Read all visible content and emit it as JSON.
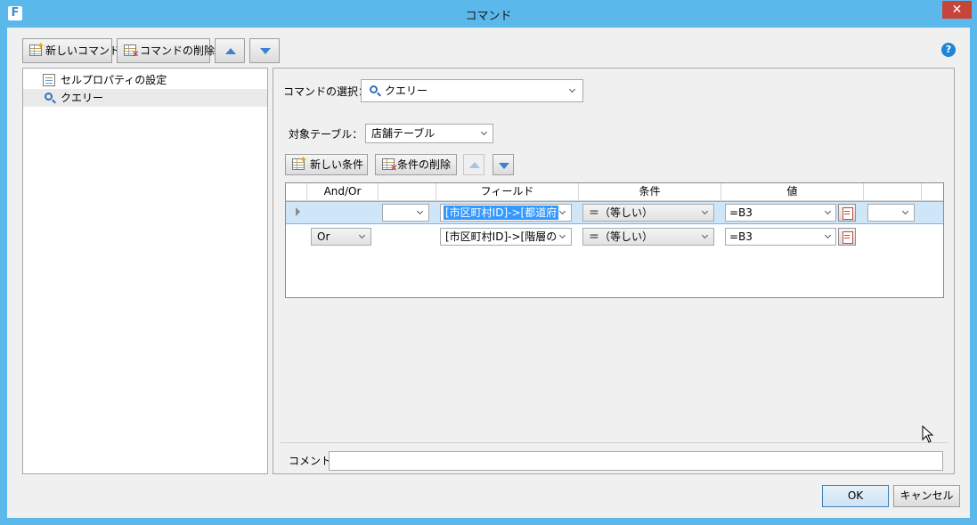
{
  "window": {
    "title": "コマンド",
    "app_icon_letter": "F",
    "close_glyph": "✕"
  },
  "toolbar": {
    "new_command_label": "新しいコマンド",
    "delete_command_label": "コマンドの削除",
    "help_glyph": "?"
  },
  "tree": {
    "items": [
      {
        "label": "セルプロパティの設定",
        "icon": "cell-property-icon"
      },
      {
        "label": "クエリー",
        "icon": "query-search-icon",
        "selected": true
      }
    ]
  },
  "command": {
    "select_label": "コマンドの選択：",
    "selected_value": "クエリー",
    "target_table_label": "対象テーブル：",
    "target_table_value": "店舗テーブル"
  },
  "conditions_toolbar": {
    "new_condition_label": "新しい条件",
    "delete_condition_label": "条件の削除"
  },
  "grid": {
    "headers": [
      "And/Or",
      "",
      "フィールド",
      "条件",
      "値",
      ""
    ],
    "rows": [
      {
        "andor": "",
        "paren": "",
        "field": "[市区町村ID]->[都道府",
        "operator": "＝（等しい）",
        "value": "=B3",
        "close_paren": ""
      },
      {
        "andor": "Or",
        "paren": "",
        "field": "[市区町村ID]->[階層の",
        "operator": "＝（等しい）",
        "value": "=B3",
        "close_paren": ""
      }
    ]
  },
  "comment": {
    "label": "コメント",
    "value": ""
  },
  "footer": {
    "ok_label": "OK",
    "cancel_label": "キャンセル"
  },
  "colors": {
    "title_bar": "#5bb8eb",
    "close_button": "#c7443b",
    "selection_row": "#cfe6f8",
    "text_highlight": "#3399ff",
    "arrow_blue": "#3f7fd0"
  }
}
